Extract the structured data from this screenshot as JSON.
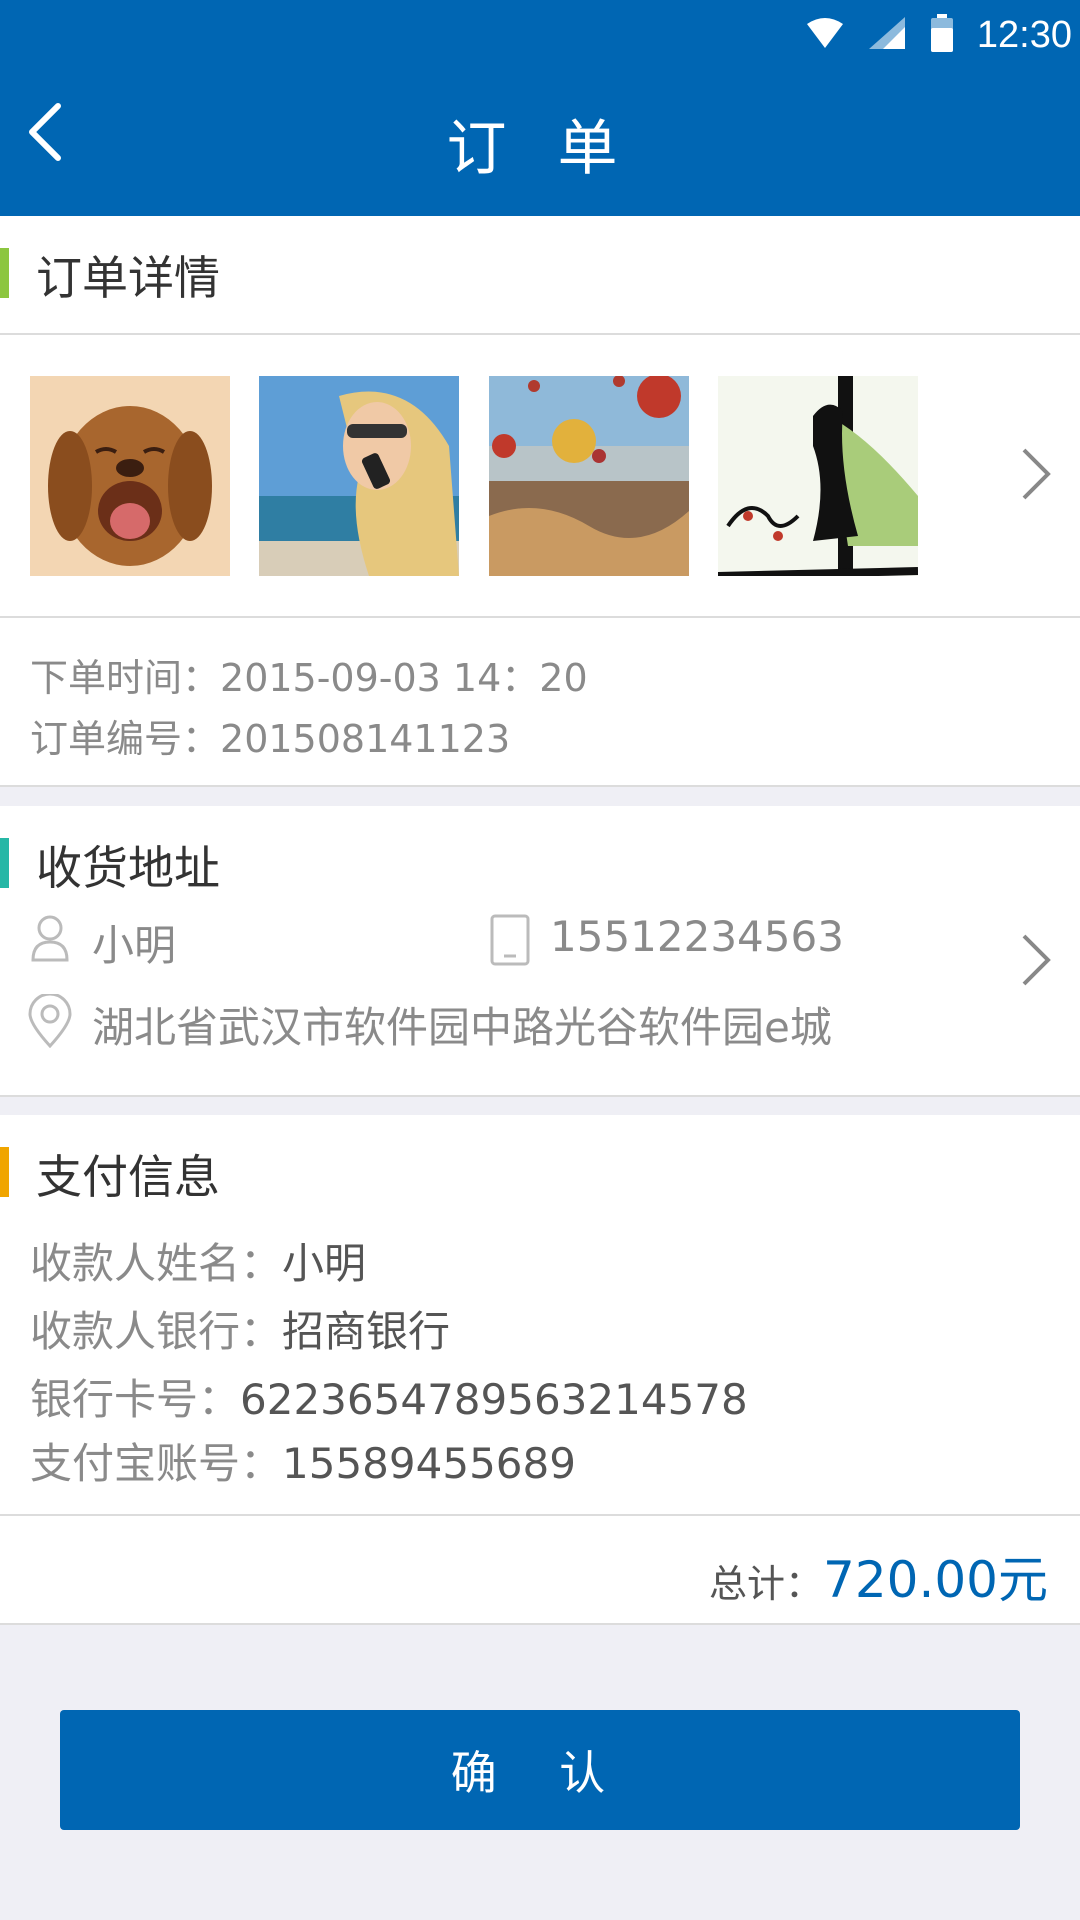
{
  "status_bar": {
    "time": "12:30",
    "icons": [
      "wifi-icon",
      "signal-icon",
      "battery-icon"
    ]
  },
  "header": {
    "title": "订 单",
    "back_icon": "back-arrow-icon"
  },
  "order_details": {
    "section_title": "订单详情",
    "accent_color": "#8cc63f",
    "images": [
      "dog-photo",
      "woman-on-phone-photo",
      "hot-air-balloons-photo",
      "silhouette-illustration"
    ],
    "order_time_label": "下单时间：",
    "order_time_value": "2015-09-03   14：20",
    "order_number_label": "订单编号：",
    "order_number_value": "201508141123"
  },
  "address": {
    "section_title": "收货地址",
    "accent_color": "#26b7a6",
    "name": "小明",
    "phone": "15512234563",
    "address": "湖北省武汉市软件园中路光谷软件园e城"
  },
  "payment": {
    "section_title": "支付信息",
    "accent_color": "#f0a500",
    "payee_name_label": "收款人姓名：",
    "payee_name_value": "小明",
    "payee_bank_label": "收款人银行：",
    "payee_bank_value": "招商银行",
    "card_number_label": "银行卡号：",
    "card_number_value": "6223654789563214578",
    "alipay_label": "支付宝账号：",
    "alipay_value": "15589455689"
  },
  "total": {
    "label": "总计：",
    "value": "720.00元"
  },
  "confirm_button": {
    "label": "确 认"
  },
  "colors": {
    "primary": "#0066b3",
    "background": "#efeff5"
  }
}
